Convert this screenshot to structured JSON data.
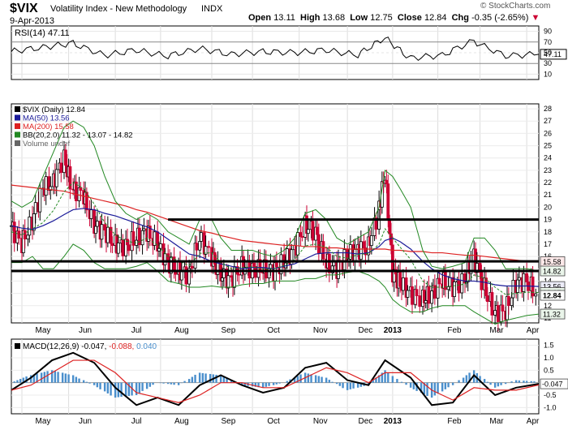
{
  "header": {
    "symbol": "$VIX",
    "name": "Volatility Index - New Methodology",
    "exchange": "INDX",
    "date": "9-Apr-2013",
    "watermark": "© StockCharts.com",
    "ohlc": {
      "open_label": "Open",
      "open": "13.11",
      "high_label": "High",
      "high": "13.68",
      "low_label": "Low",
      "low": "12.75",
      "close_label": "Close",
      "close": "12.84",
      "chg_label": "Chg",
      "chg": "-0.35 (-2.65%)"
    }
  },
  "rsi_panel": {
    "legend": "RSI(14) 47.11",
    "axis_ticks": [
      "90",
      "70",
      "50",
      "30",
      "10"
    ],
    "current_value": "47.11"
  },
  "price_panel": {
    "legend": [
      "$VIX (Daily) 12.84",
      "MA(50) 13.56",
      "MA(200) 15.58",
      "BB(20,2.0) 11.32 - 13.07 - 14.82",
      "Volume undef"
    ],
    "axis_ticks": [
      "28",
      "27",
      "26",
      "25",
      "24",
      "23",
      "22",
      "21",
      "20",
      "19",
      "18",
      "17",
      "16",
      "15",
      "14",
      "13",
      "12",
      "11"
    ],
    "right_tags": [
      "15.58",
      "14.82",
      "13.56",
      "13.07",
      "12.84",
      "11.32"
    ]
  },
  "macd_panel": {
    "legend_prefix": "MACD(12,26,9)",
    "legend_values": [
      "-0.047",
      "-0.088",
      "0.040"
    ],
    "axis_ticks": [
      "1.5",
      "1.0",
      "0.5",
      "0.0",
      "-0.5",
      "-1.0"
    ],
    "current_value": "-0.047"
  },
  "x_labels": [
    "May",
    "Jun",
    "Jul",
    "Aug",
    "Sep",
    "Oct",
    "Nov",
    "Dec",
    "2013",
    "Feb",
    "Mar",
    "Apr"
  ],
  "colors": {
    "up": "#000000",
    "down": "#cc0033",
    "ma50": "#1a1a99",
    "ma200": "#dd2222",
    "bb": "#228822",
    "rsi": "#000000",
    "macd": "#000000",
    "signal": "#dd2222",
    "hist": "#4a8fcc",
    "hline": "#000000"
  },
  "chart_data": [
    {
      "type": "line",
      "title": "RSI(14)",
      "ylim": [
        0,
        100
      ],
      "x": [
        "2012-04-24",
        "2012-05-15",
        "2012-06-04",
        "2012-06-25",
        "2012-07-16",
        "2012-08-06",
        "2012-08-27",
        "2012-09-17",
        "2012-10-08",
        "2012-10-29",
        "2012-11-19",
        "2012-12-10",
        "2012-12-28",
        "2013-01-14",
        "2013-02-04",
        "2013-02-25",
        "2013-03-18",
        "2013-04-09"
      ],
      "series": [
        {
          "name": "RSI(14)",
          "values": [
            52,
            60,
            68,
            45,
            55,
            44,
            58,
            47,
            52,
            50,
            55,
            46,
            78,
            40,
            45,
            72,
            44,
            47.11
          ]
        }
      ]
    },
    {
      "type": "line",
      "title": "$VIX (Daily)",
      "ylim": [
        11,
        28
      ],
      "x": [
        "2012-04-24",
        "2012-05-01",
        "2012-05-08",
        "2012-05-15",
        "2012-05-22",
        "2012-05-29",
        "2012-06-04",
        "2012-06-11",
        "2012-06-18",
        "2012-06-25",
        "2012-07-02",
        "2012-07-09",
        "2012-07-16",
        "2012-07-23",
        "2012-07-30",
        "2012-08-06",
        "2012-08-13",
        "2012-08-20",
        "2012-08-27",
        "2012-09-04",
        "2012-09-10",
        "2012-09-17",
        "2012-09-24",
        "2012-10-01",
        "2012-10-08",
        "2012-10-15",
        "2012-10-22",
        "2012-10-29",
        "2012-11-05",
        "2012-11-12",
        "2012-11-19",
        "2012-11-26",
        "2012-12-03",
        "2012-12-10",
        "2012-12-17",
        "2012-12-24",
        "2012-12-28",
        "2013-01-02",
        "2013-01-07",
        "2013-01-14",
        "2013-01-22",
        "2013-01-28",
        "2013-02-04",
        "2013-02-11",
        "2013-02-19",
        "2013-02-25",
        "2013-03-04",
        "2013-03-11",
        "2013-03-18",
        "2013-03-25",
        "2013-04-01",
        "2013-04-09"
      ],
      "series": [
        {
          "name": "$VIX (Daily)",
          "values": [
            18.5,
            17.0,
            18.8,
            21.5,
            22.0,
            24.0,
            21.5,
            21.0,
            18.5,
            18.0,
            17.0,
            16.8,
            17.5,
            18.0,
            17.0,
            15.5,
            14.8,
            14.5,
            17.5,
            16.0,
            14.5,
            14.0,
            15.2,
            15.0,
            15.0,
            14.8,
            15.5,
            16.5,
            18.5,
            18.0,
            15.5,
            15.0,
            16.0,
            16.5,
            16.8,
            19.5,
            22.7,
            14.7,
            13.8,
            13.0,
            12.5,
            13.0,
            14.0,
            13.5,
            14.0,
            16.0,
            13.5,
            11.5,
            11.5,
            13.8,
            14.0,
            12.84
          ]
        },
        {
          "name": "MA(50)",
          "values": [
            18.5,
            18.3,
            18.2,
            18.5,
            18.9,
            19.4,
            19.8,
            19.9,
            19.8,
            19.5,
            19.3,
            19.0,
            18.7,
            18.4,
            18.0,
            17.4,
            16.8,
            16.2,
            16.0,
            15.6,
            15.4,
            15.2,
            15.0,
            15.1,
            15.1,
            15.0,
            15.2,
            15.4,
            15.8,
            16.2,
            16.3,
            16.3,
            16.3,
            16.2,
            16.3,
            16.8,
            17.3,
            17.5,
            17.2,
            16.6,
            15.6,
            15.0,
            14.5,
            14.2,
            14.0,
            14.0,
            13.9,
            13.7,
            13.6,
            13.6,
            13.6,
            13.56
          ]
        },
        {
          "name": "MA(200)",
          "values": [
            21.8,
            21.7,
            21.6,
            21.5,
            21.4,
            21.3,
            21.1,
            20.9,
            20.7,
            20.5,
            20.3,
            20.1,
            19.8,
            19.6,
            19.3,
            19.0,
            18.7,
            18.4,
            18.1,
            17.9,
            17.7,
            17.5,
            17.3,
            17.2,
            17.1,
            17.0,
            16.9,
            16.9,
            16.8,
            16.8,
            16.7,
            16.7,
            16.6,
            16.6,
            16.6,
            16.6,
            16.6,
            16.5,
            16.5,
            16.4,
            16.4,
            16.3,
            16.3,
            16.2,
            16.1,
            16.1,
            16.0,
            15.9,
            15.8,
            15.7,
            15.6,
            15.58
          ]
        },
        {
          "name": "BB Upper",
          "values": [
            20.5,
            20.0,
            20.5,
            22.5,
            24.5,
            26.5,
            27.0,
            26.5,
            25.0,
            22.5,
            20.5,
            19.5,
            19.0,
            19.5,
            19.0,
            18.0,
            17.5,
            17.0,
            19.0,
            19.0,
            17.5,
            16.5,
            16.5,
            16.5,
            16.2,
            16.0,
            16.5,
            17.5,
            19.5,
            19.8,
            19.0,
            17.5,
            17.0,
            17.5,
            18.0,
            20.0,
            23.0,
            22.5,
            21.5,
            20.0,
            16.5,
            15.2,
            15.0,
            15.2,
            15.5,
            17.5,
            17.5,
            16.5,
            15.0,
            15.0,
            15.0,
            14.82
          ]
        },
        {
          "name": "BB Lower",
          "values": [
            15.5,
            15.5,
            16.0,
            15.0,
            15.0,
            16.0,
            17.0,
            16.5,
            15.5,
            15.0,
            15.0,
            15.0,
            15.2,
            15.5,
            14.8,
            14.0,
            13.8,
            13.5,
            13.5,
            13.6,
            13.5,
            13.5,
            13.7,
            13.8,
            13.8,
            14.0,
            14.0,
            14.0,
            14.2,
            14.2,
            14.5,
            14.5,
            14.7,
            14.8,
            14.5,
            14.0,
            13.5,
            12.5,
            12.0,
            11.5,
            11.5,
            11.8,
            12.0,
            12.0,
            12.0,
            11.5,
            11.0,
            10.5,
            10.8,
            11.0,
            11.2,
            11.32
          ]
        }
      ]
    },
    {
      "type": "line",
      "title": "MACD(12,26,9)",
      "ylim": [
        -1.2,
        1.7
      ],
      "x": [
        "2012-04-24",
        "2012-05-07",
        "2012-05-21",
        "2012-06-04",
        "2012-06-18",
        "2012-07-02",
        "2012-07-16",
        "2012-07-30",
        "2012-08-13",
        "2012-08-27",
        "2012-09-10",
        "2012-09-24",
        "2012-10-08",
        "2012-10-22",
        "2012-11-05",
        "2012-11-19",
        "2012-12-03",
        "2012-12-17",
        "2012-12-28",
        "2013-01-14",
        "2013-01-28",
        "2013-02-11",
        "2013-02-25",
        "2013-03-11",
        "2013-03-25",
        "2013-04-09"
      ],
      "series": [
        {
          "name": "MACD",
          "values": [
            -0.3,
            0.2,
            0.9,
            1.2,
            0.8,
            -0.2,
            -0.9,
            -0.6,
            -0.9,
            -0.1,
            0.3,
            -0.1,
            -0.4,
            -0.2,
            0.6,
            0.8,
            0.1,
            -0.1,
            0.9,
            0.2,
            -0.9,
            -0.8,
            0.3,
            -0.5,
            -0.2,
            -0.047
          ]
        },
        {
          "name": "Signal",
          "values": [
            -0.3,
            -0.1,
            0.4,
            0.9,
            0.9,
            0.4,
            -0.4,
            -0.6,
            -0.8,
            -0.5,
            0.0,
            0.0,
            -0.2,
            -0.2,
            0.2,
            0.6,
            0.4,
            0.0,
            0.4,
            0.4,
            -0.3,
            -0.7,
            -0.2,
            -0.3,
            -0.3,
            -0.088
          ]
        },
        {
          "name": "Histogram",
          "values": [
            0.0,
            0.3,
            0.5,
            0.3,
            -0.1,
            -0.6,
            -0.5,
            0.0,
            -0.1,
            0.4,
            0.3,
            -0.1,
            -0.2,
            0.0,
            0.4,
            0.2,
            -0.3,
            -0.1,
            0.5,
            -0.2,
            -0.6,
            -0.1,
            0.5,
            -0.2,
            0.1,
            0.04
          ]
        }
      ]
    }
  ]
}
